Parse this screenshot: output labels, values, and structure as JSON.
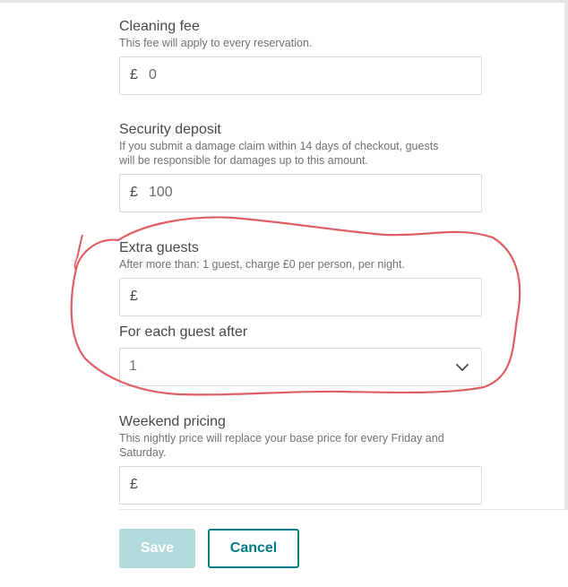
{
  "cleaning_fee": {
    "title": "Cleaning fee",
    "description": "This fee will apply to every reservation.",
    "currency": "£",
    "value": "0"
  },
  "security_deposit": {
    "title": "Security deposit",
    "description_line1": "If you submit a damage claim within 14 days of checkout, guests",
    "description_line2": "will be responsible for damages up to this amount.",
    "currency": "£",
    "value": "100"
  },
  "extra_guests": {
    "title": "Extra guests",
    "description": "After more than: 1 guest, charge £0 per person, per night.",
    "currency": "£",
    "value": ""
  },
  "each_guest_after": {
    "title": "For each guest after",
    "selected": "1"
  },
  "weekend_pricing": {
    "title": "Weekend pricing",
    "description_line1": "This nightly price will replace your base price for every Friday and",
    "description_line2": "Saturday.",
    "currency": "£",
    "value": ""
  },
  "actions": {
    "save_label": "Save",
    "cancel_label": "Cancel"
  },
  "colors": {
    "primary_teal": "#007a87",
    "save_disabled": "#b1dcdb",
    "annotation_red": "#d9424b"
  },
  "icons": {
    "select_arrow": "chevron-down-icon"
  }
}
